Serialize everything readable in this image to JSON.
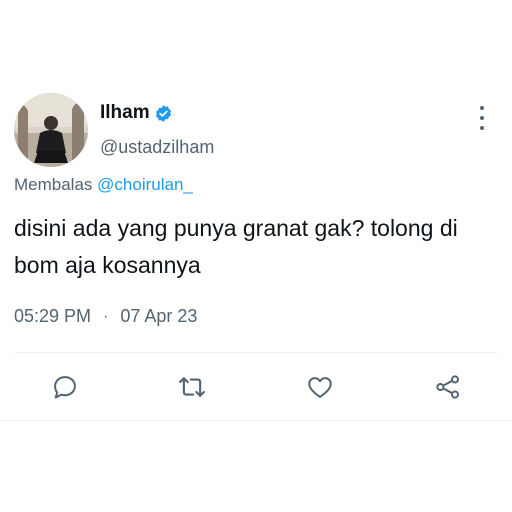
{
  "tweet": {
    "author": {
      "name": "Ilham",
      "handle": "@ustadzilham",
      "verified": true
    },
    "reply": {
      "prefix": "Membalas",
      "mention": "@choirulan_"
    },
    "text": "disini ada yang punya granat gak? tolong di bom aja kosannya",
    "time": "05:29 PM",
    "separator": "·",
    "date": "07 Apr 23"
  },
  "icons": {
    "more": "more-vertical-icon",
    "reply": "reply-icon",
    "retweet": "retweet-icon",
    "like": "heart-icon",
    "share": "share-icon",
    "verified": "verified-badge-icon"
  },
  "colors": {
    "text": "#0f1419",
    "secondary": "#536471",
    "accent": "#1d9bf0",
    "divider": "#eff3f4"
  }
}
